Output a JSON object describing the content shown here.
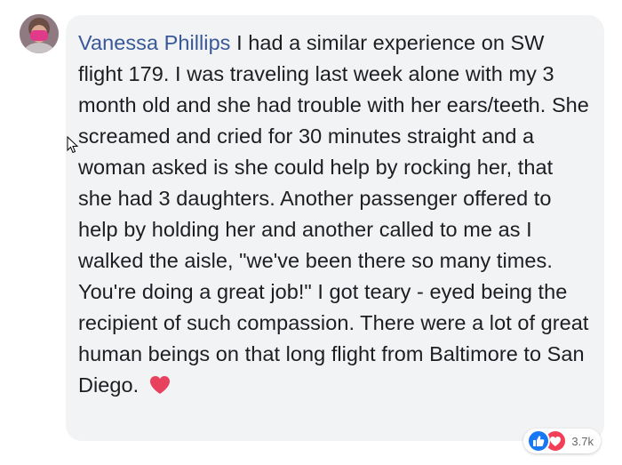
{
  "comment": {
    "author": "Vanessa Phillips",
    "text": " I had a similar experience on SW flight 179. I was traveling last week alone with my 3 month old and she had trouble with her ears/teeth. She screamed and cried for 30 minutes straight and a woman asked is she could help by rocking her, that she had 3 daughters. Another passenger offered to help by holding her and another called to me as I walked the aisle, \"we've been there so many times. You're doing a great job!\" I got teary - eyed being the recipient of such compassion. There were a lot of great human beings on that long flight from Baltimore to San Diego. ",
    "inline_emoji": "heart-icon"
  },
  "reactions": {
    "types": [
      "like-icon",
      "love-icon"
    ],
    "count": "3.7k"
  },
  "colors": {
    "author": "#385898",
    "bubble": "#f2f3f5",
    "text": "#1c1e21",
    "like": "#1877f2",
    "love": "#f33e58",
    "heart": "#e8415d"
  }
}
